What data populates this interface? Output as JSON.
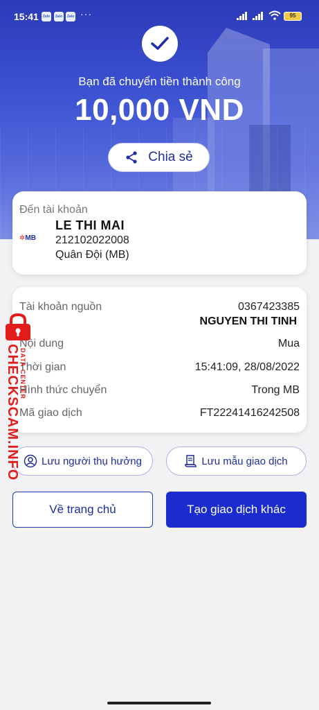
{
  "status_bar": {
    "time": "15:41",
    "app_icons": [
      "Zalo",
      "Zalo",
      "Zalo"
    ],
    "dots": "···",
    "battery": "95"
  },
  "hero": {
    "title": "Bạn đã chuyển tiền thành công",
    "amount": "10,000 VND",
    "share_label": "Chia sẻ"
  },
  "destination": {
    "label": "Đến tài khoản",
    "bank_logo": "MB",
    "name": "LE THI MAI",
    "account": "212102022008",
    "bank": "Quân Đội (MB)"
  },
  "details": {
    "source_label": "Tài khoản nguồn",
    "source_account": "0367423385",
    "source_name": "NGUYEN THI TINH",
    "content_label": "Nội dung",
    "content_value": "Mua",
    "time_label": "Thời gian",
    "time_value": "15:41:09, 28/08/2022",
    "method_label": "Hình thức chuyển",
    "method_value": "Trong MB",
    "txn_label": "Mã giao dịch",
    "txn_value": "FT22241416242508"
  },
  "actions": {
    "save_beneficiary": "Lưu người thụ hưởng",
    "save_template": "Lưu mẫu giao dịch",
    "home": "Về trang chủ",
    "new_transaction": "Tạo giao dịch khác"
  },
  "watermark": {
    "main": "CHECKSCAM.INFO",
    "sub": "DATA CENTER"
  },
  "colors": {
    "primary": "#1a2bd0",
    "hero_top": "#2b3ab8",
    "watermark": "#e21b1b"
  }
}
